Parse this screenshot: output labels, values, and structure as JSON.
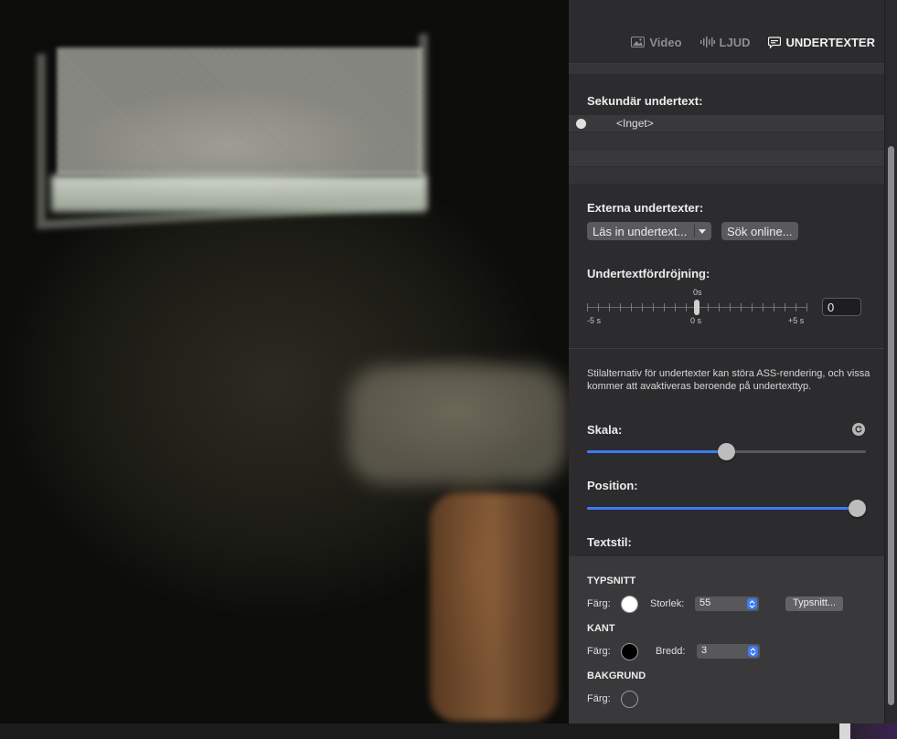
{
  "tabs": [
    {
      "label": "Video",
      "icon": "image-icon",
      "active": false
    },
    {
      "label": "LJUD",
      "icon": "waveform-icon",
      "active": false
    },
    {
      "label": "UNDERTEXTER",
      "icon": "speech-bubble-icon",
      "active": true
    }
  ],
  "secondary": {
    "label": "Sekundär undertext:",
    "items": [
      "<Inget>",
      "",
      "",
      ""
    ]
  },
  "external": {
    "label": "Externa undertexter:",
    "load_label": "Läs in undertext...",
    "search_label": "Sök online..."
  },
  "delay": {
    "label": "Undertextfördröjning:",
    "current_label": "0s",
    "min_label": "-5 s",
    "mid_label": "0 s",
    "max_label": "+5 s",
    "value": "0",
    "slider_value": 0,
    "range": [
      -5,
      5
    ]
  },
  "info": "Stilalternativ för undertexter kan störa ASS-rendering, och vissa kommer att avaktiveras beroende på undertexttyp.",
  "scale": {
    "label": "Skala:",
    "value_fraction": 0.5
  },
  "position": {
    "label": "Position:",
    "value_fraction": 1.0
  },
  "textstyle": {
    "label": "Textstil:",
    "font": {
      "title": "TYPSNITT",
      "color_label": "Färg:",
      "color": "#ffffff",
      "size_label": "Storlek:",
      "size_value": "55",
      "font_button": "Typsnitt..."
    },
    "border": {
      "title": "KANT",
      "color_label": "Färg:",
      "color": "#000000",
      "width_label": "Bredd:",
      "width_value": "3"
    },
    "background": {
      "title": "BAKGRUND",
      "color_label": "Färg:",
      "color": "transparent"
    }
  },
  "colors": {
    "accent": "#3d7bf5",
    "panel": "#2c2c2e"
  }
}
